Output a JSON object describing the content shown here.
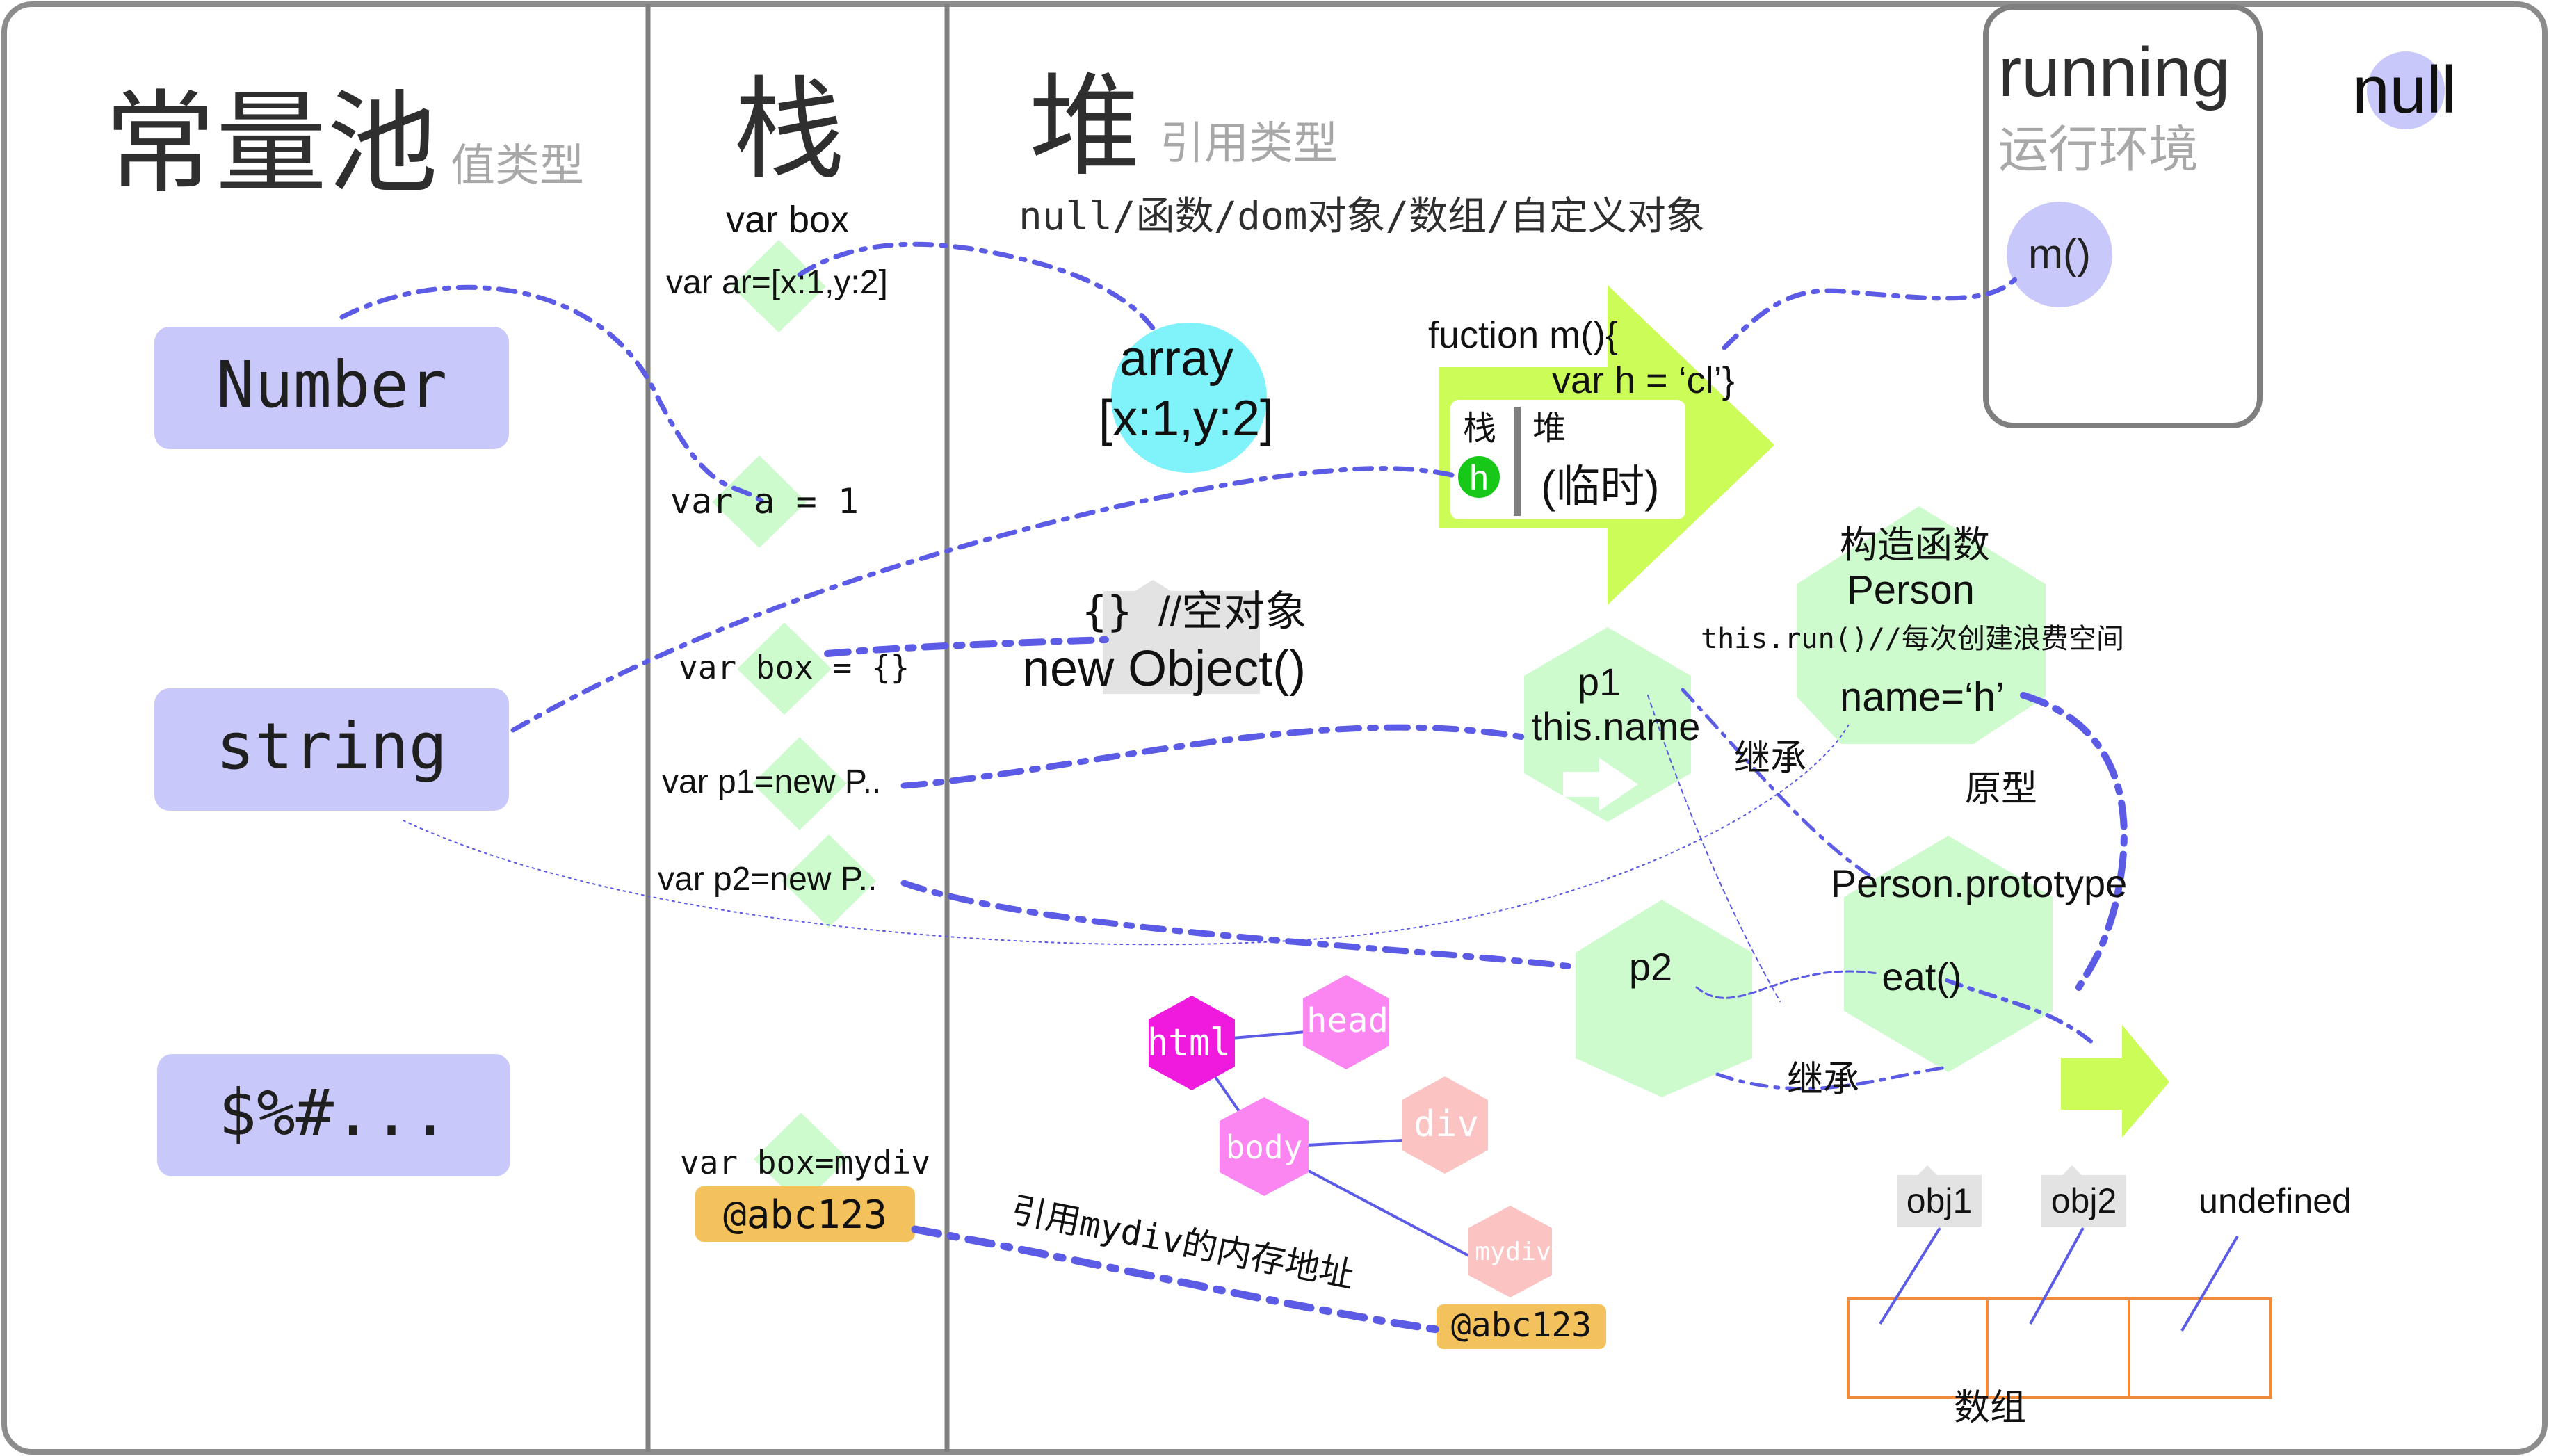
{
  "sections": {
    "pool": {
      "title": "常量池",
      "subtitle": "值类型"
    },
    "stack": {
      "title": "栈"
    },
    "heap": {
      "title": "堆",
      "subtitle": "引用类型",
      "types_note": "null/函数/dom对象/数组/自定义对象"
    },
    "running": {
      "title": "running",
      "subtitle": "运行环境",
      "item": "m()"
    }
  },
  "null_label": "null",
  "pool_items": [
    "Number",
    "string",
    "$%#..."
  ],
  "stack_items": {
    "var_box": "var box",
    "var_arr": "var ar=[x:1,y:2]",
    "var_a": "var a = 1",
    "var_obj": "var box = {}",
    "var_p1": "var p1=new P..",
    "var_p2": "var p2=new P..",
    "var_dom": "var box=mydiv",
    "address": "@abc123"
  },
  "array_node": {
    "line1": "array",
    "line2": "[x:1,y:2]"
  },
  "function_box": {
    "line1": "fuction m(){",
    "line2": "var h = ‘cl’}",
    "stack": "栈",
    "heap": "堆",
    "temp": "(临时)",
    "var": "h"
  },
  "empty_object": {
    "braces": "{}",
    "comment": "//空对象",
    "ctor": "new Object()"
  },
  "constructor_node": {
    "line1": "构造函数",
    "line2": "Person",
    "run_note": "this.run()//每次创建浪费空间",
    "name": "name=‘h’"
  },
  "p1_node": {
    "line1": "p1",
    "line2": "this.name"
  },
  "p2_node": {
    "label": "p2"
  },
  "prototype_node": {
    "line1": "Person.prototype",
    "line2": "eat()"
  },
  "labels": {
    "inherit1": "继承",
    "inherit2": "继承",
    "prototype": "原型"
  },
  "dom_nodes": [
    "html",
    "head",
    "body",
    "div",
    "mydiv"
  ],
  "dom_note": "引用mydiv的内存地址",
  "heap_address": "@abc123",
  "array_items": {
    "obj1": "obj1",
    "obj2": "obj2",
    "undef": "undefined",
    "caption": "数组"
  },
  "colors": {
    "border": "#7f7f7f",
    "pool_box": "#c9c8fa",
    "connector": "#5b5be6",
    "node_green": "#cdfbcd",
    "cyan": "#7ff3f9",
    "lime": "#ccfc58",
    "address": "#f3c25c",
    "magenta": "#f01adf",
    "pink": "#fb86f1",
    "salmon": "#fcc3c3",
    "array_border": "#f08a3c"
  }
}
